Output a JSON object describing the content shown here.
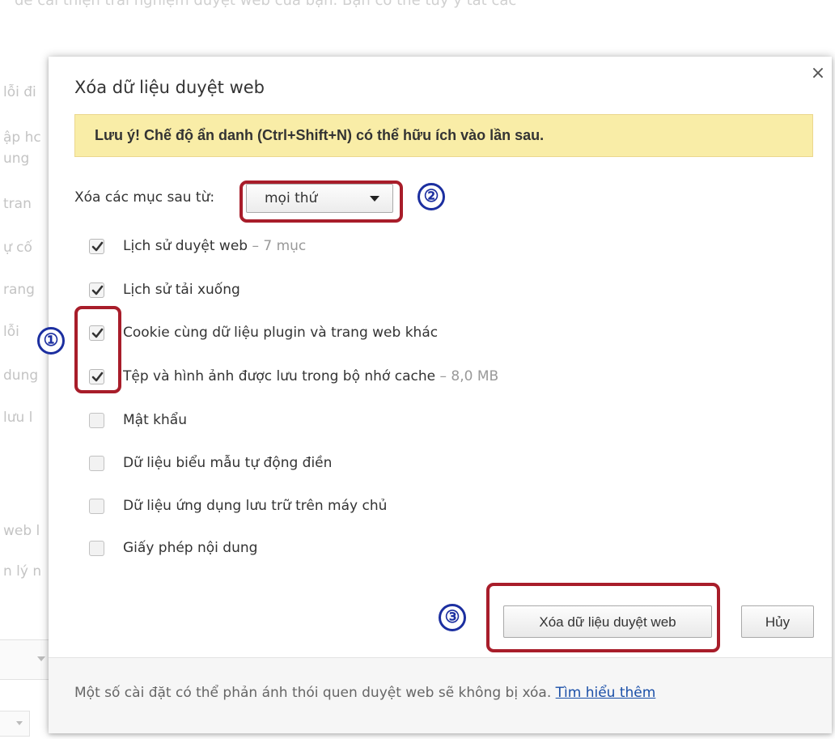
{
  "background": {
    "top_text": "để cải thiện trải nghiệm duyệt web của bạn. Bạn có thể tùy ý tắt các",
    "left_fragments": [
      "lỗi đi",
      "ập hc",
      "ung",
      "tran",
      "ự cố",
      "rang",
      "lỗi",
      "dung",
      "lưu l",
      "web l",
      "n lý n"
    ]
  },
  "dialog": {
    "title": "Xóa dữ liệu duyệt web",
    "close_glyph": "×",
    "warning": "Lưu ý! Chế độ ẩn danh (Ctrl+Shift+N) có thể hữu ích vào lần sau.",
    "range": {
      "label": "Xóa các mục sau từ:",
      "selected": "mọi thứ"
    },
    "checkboxes": [
      {
        "label": "Lịch sử duyệt web",
        "meta": " – 7 mục",
        "checked": true
      },
      {
        "label": "Lịch sử tải xuống",
        "meta": "",
        "checked": true
      },
      {
        "label": "Cookie cùng dữ liệu plugin và trang web khác",
        "meta": "",
        "checked": true
      },
      {
        "label": "Tệp và hình ảnh được lưu trong bộ nhớ cache",
        "meta": " – 8,0 MB",
        "checked": true
      },
      {
        "label": "Mật khẩu",
        "meta": "",
        "checked": false
      },
      {
        "label": "Dữ liệu biểu mẫu tự động điền",
        "meta": "",
        "checked": false
      },
      {
        "label": "Dữ liệu ứng dụng lưu trữ trên máy chủ",
        "meta": "",
        "checked": false
      },
      {
        "label": "Giấy phép nội dung",
        "meta": "",
        "checked": false
      }
    ],
    "buttons": {
      "clear": "Xóa dữ liệu duyệt web",
      "cancel": "Hủy"
    },
    "footer": {
      "text": "Một số cài đặt có thể phản ánh thói quen duyệt web sẽ không bị xóa.",
      "link": "Tìm hiểu thêm"
    }
  },
  "annotations": {
    "step1": "①",
    "step2": "②",
    "step3": "③",
    "highlight_color": "#a81d2a",
    "number_color": "#1c2fa0"
  }
}
